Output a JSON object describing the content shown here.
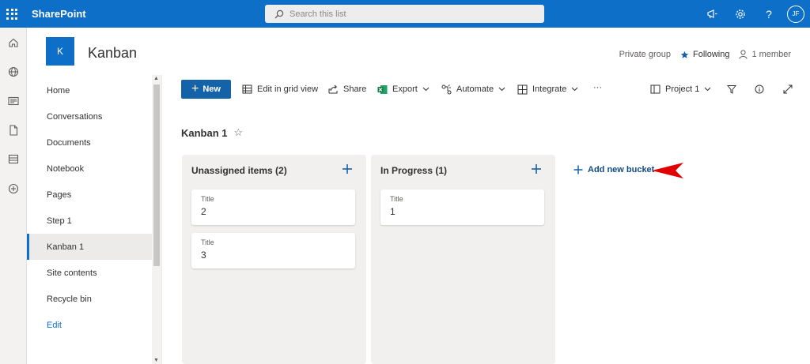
{
  "app": {
    "brand": "SharePoint"
  },
  "search": {
    "placeholder": "Search this list"
  },
  "topbar": {
    "avatar_initials": "JF",
    "icons": [
      "megaphone-icon",
      "gear-icon",
      "help-icon"
    ]
  },
  "site": {
    "logo_letter": "K",
    "title": "Kanban",
    "privacy": "Private group",
    "following": "Following",
    "members": "1 member"
  },
  "nav": {
    "items": [
      {
        "label": "Home"
      },
      {
        "label": "Conversations"
      },
      {
        "label": "Documents"
      },
      {
        "label": "Notebook"
      },
      {
        "label": "Pages"
      },
      {
        "label": "Step 1"
      },
      {
        "label": "Kanban 1",
        "selected": true
      },
      {
        "label": "Site contents"
      },
      {
        "label": "Recycle bin"
      }
    ],
    "edit": "Edit"
  },
  "commands": {
    "new": "New",
    "grid": "Edit in grid view",
    "share": "Share",
    "export": "Export",
    "automate": "Automate",
    "integrate": "Integrate",
    "more": "···",
    "view": "Project 1"
  },
  "view": {
    "title": "Kanban 1",
    "star": "☆"
  },
  "buckets": [
    {
      "title": "Unassigned items (2)",
      "cards": [
        {
          "label": "Title",
          "value": "2"
        },
        {
          "label": "Title",
          "value": "3"
        }
      ]
    },
    {
      "title": "In Progress (1)",
      "cards": [
        {
          "label": "Title",
          "value": "1"
        }
      ]
    }
  ],
  "add_bucket": "Add new bucket",
  "colors": {
    "brand": "#0e6fc9",
    "primary_button": "#1462a8",
    "annotation_arrow": "#e00000"
  }
}
